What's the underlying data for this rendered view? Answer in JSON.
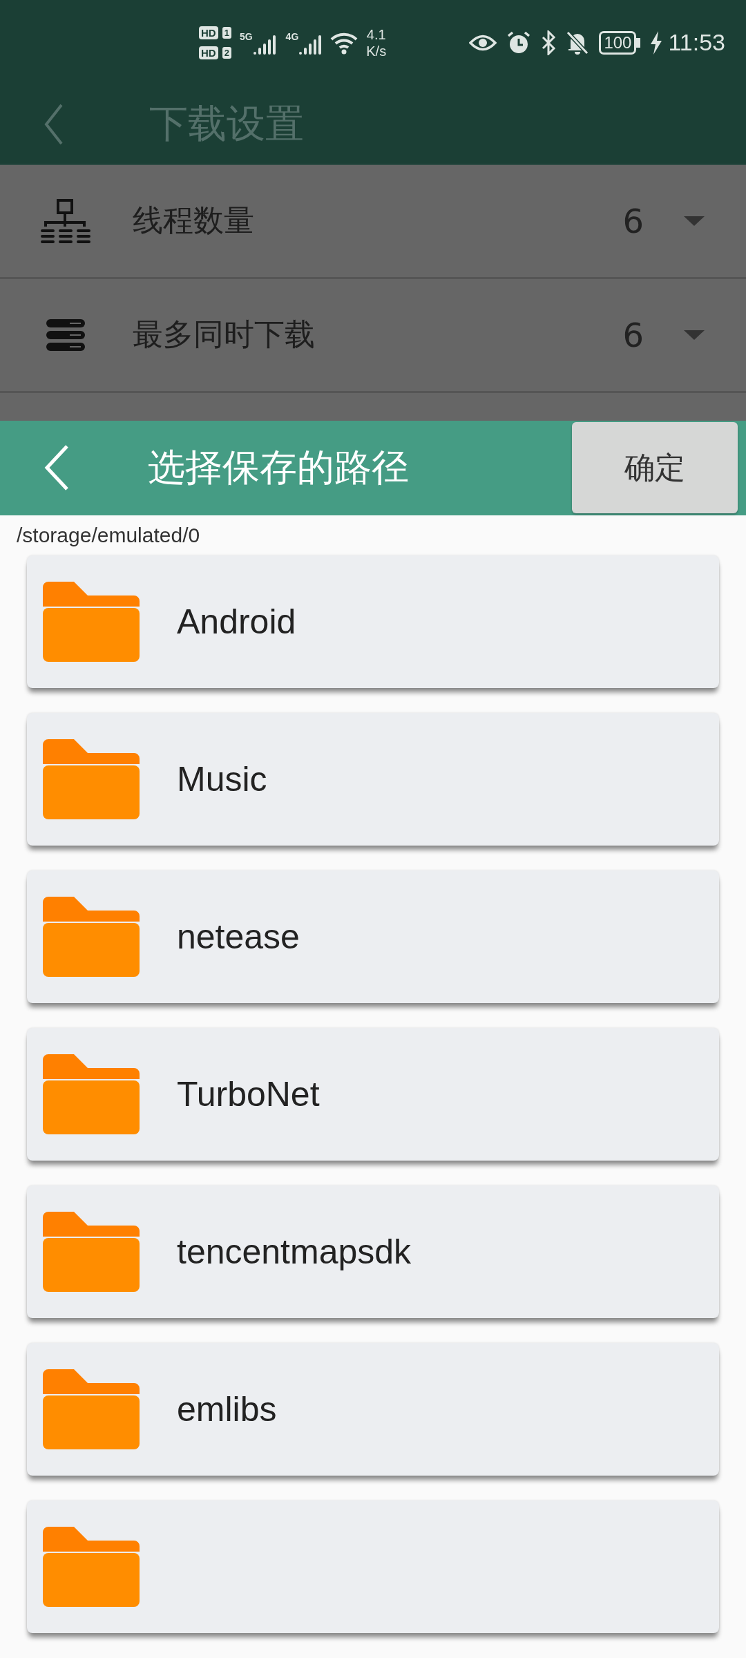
{
  "status_bar": {
    "sim_badges": [
      {
        "label": "HD",
        "slot": "1"
      },
      {
        "label": "HD",
        "slot": "2"
      }
    ],
    "networks": [
      "5G",
      "4G"
    ],
    "speed": "4.1",
    "speed_unit": "K/s",
    "battery": "100",
    "time": "11:53"
  },
  "app_bar": {
    "title": "下载设置"
  },
  "settings": [
    {
      "kind": "threads",
      "label": "线程数量",
      "value": "6"
    },
    {
      "kind": "downloads",
      "label": "最多同时下载",
      "value": "6"
    }
  ],
  "dialog": {
    "title": "选择保存的路径",
    "confirm": "确定",
    "path": "/storage/emulated/0",
    "folders": [
      {
        "kind": "folder",
        "name": "Android"
      },
      {
        "kind": "folder",
        "name": "Music"
      },
      {
        "kind": "folder",
        "name": "netease"
      },
      {
        "kind": "folder",
        "name": "TurboNet"
      },
      {
        "kind": "folder",
        "name": "tencentmapsdk"
      },
      {
        "kind": "folder",
        "name": "emlibs"
      },
      {
        "kind": "partial"
      }
    ]
  }
}
